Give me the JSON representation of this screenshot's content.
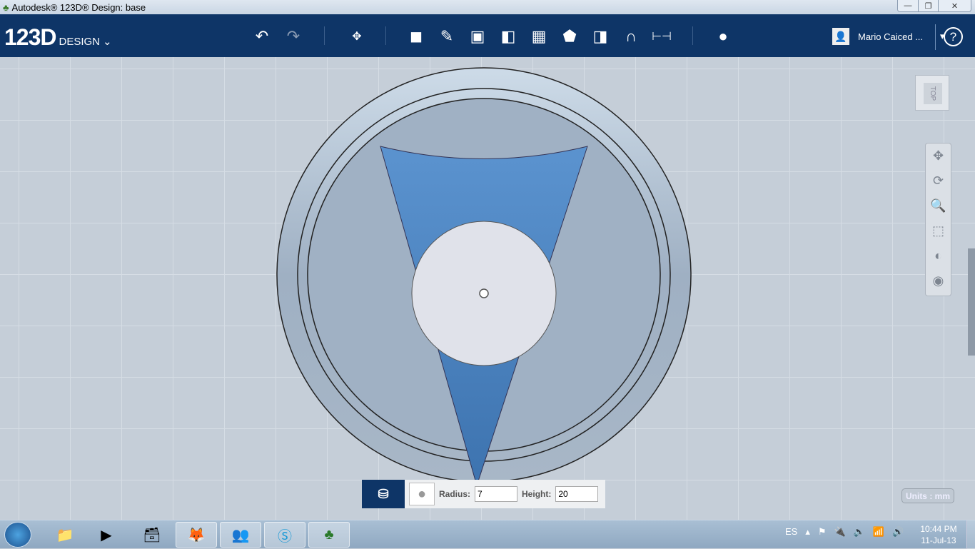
{
  "window": {
    "title": "Autodesk® 123D® Design: base",
    "minimize": "—",
    "restore": "❐",
    "close": "✕"
  },
  "toolbar": {
    "logo_main": "123D",
    "logo_sub": "DESIGN",
    "logo_caret": "⌄",
    "user_name": "Mario Caiced ...",
    "user_caret": "▾",
    "help": "?"
  },
  "viewport": {
    "viewcube_label": "TOP",
    "units_label": "Units : mm"
  },
  "panel": {
    "radius_label": "Radius:",
    "radius_value": "7",
    "height_label": "Height:",
    "height_value": "20"
  },
  "taskbar": {
    "language": "ES",
    "time": "10:44 PM",
    "date": "11-Jul-13"
  },
  "colors": {
    "toolbar": "#0e3567",
    "sketch_blue": "#4f86c0",
    "disc": "#e0e2ea"
  }
}
